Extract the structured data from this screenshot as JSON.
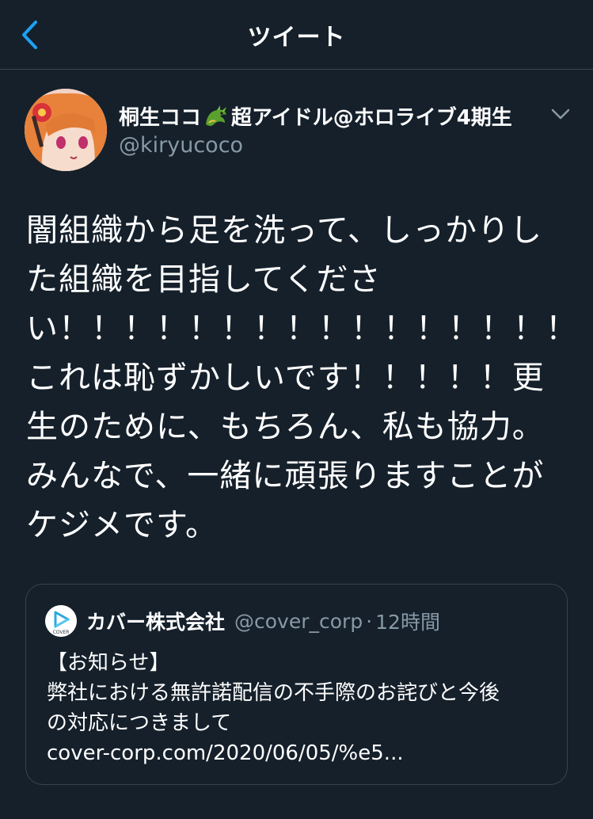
{
  "header": {
    "title": "ツイート"
  },
  "author": {
    "display_name_part1": "桐生ココ",
    "display_name_part2": "超アイドル@ホロライブ4期生",
    "username": "@kiryucoco"
  },
  "tweet": {
    "text": "闇組織から足を洗って、しっかりした組織を目指してください！！！！！！！！！！！！！！！！これは恥ずかしいです！！！！！更生のために、もちろん、私も協力。みんなで、一緒に頑張りますことがケジメです。"
  },
  "quote": {
    "name": "カバー株式会社",
    "logo_text": "COVER",
    "handle": "@cover_corp",
    "dot": "·",
    "time": "12時間",
    "lines": [
      "【お知らせ】",
      "弊社における無許諾配信の不手際のお詫びと今後",
      "の対応につきまして",
      "cover-corp.com/2020/06/05/%e5..."
    ]
  },
  "colors": {
    "background": "#15202b",
    "accent": "#1da1f2",
    "secondary_text": "#8899a6",
    "border": "#38444d"
  }
}
